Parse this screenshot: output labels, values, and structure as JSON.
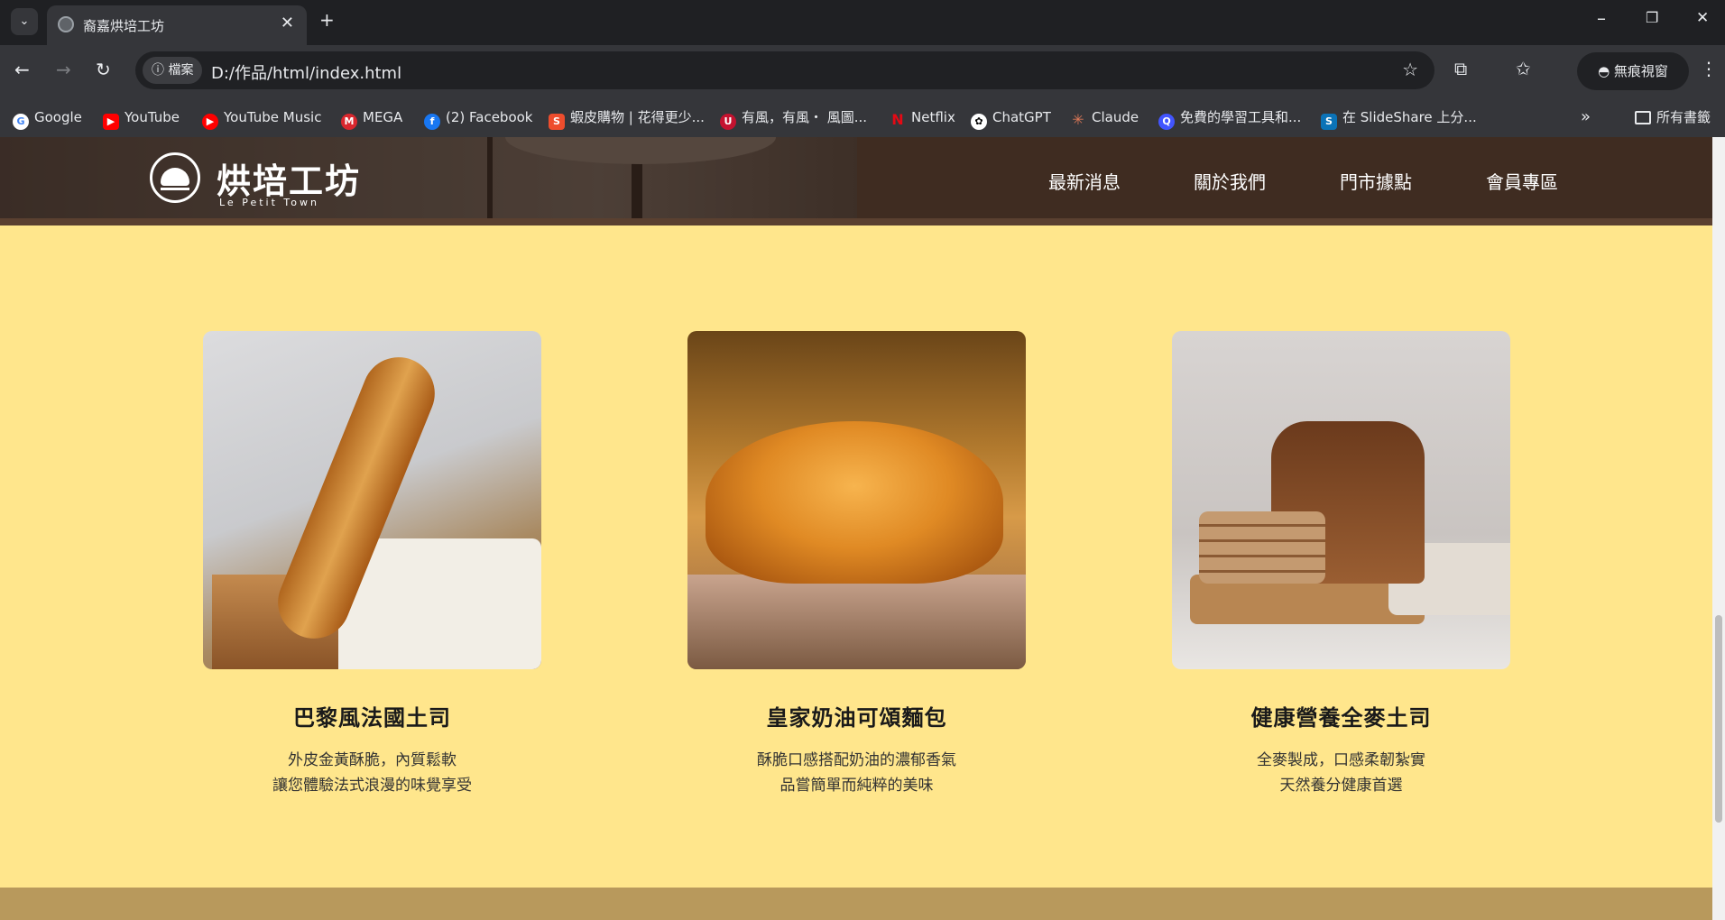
{
  "browser": {
    "tab_title": "裔嘉烘培工坊",
    "url_chip": "檔案",
    "url": "D:/作品/html/index.html",
    "incognito_label": "無痕視窗",
    "bookmarks": [
      "Google",
      "YouTube",
      "YouTube Music",
      "MEGA",
      "(2) Facebook",
      "蝦皮購物 | 花得更少...",
      "有風，有風・ 風圖...",
      "Netflix",
      "ChatGPT",
      "Claude",
      "免費的學習工具和...",
      "在 SlideShare 上分..."
    ],
    "all_bookmarks_label": "所有書籤"
  },
  "site": {
    "brand": "烘培工坊",
    "brand_sub": "Le Petit Town",
    "nav": [
      "最新消息",
      "關於我們",
      "門市據點",
      "會員專區"
    ]
  },
  "products": [
    {
      "name": "巴黎風法國土司",
      "desc1": "外皮金黃酥脆，內質鬆軟",
      "desc2": "讓您體驗法式浪漫的味覺享受"
    },
    {
      "name": "皇家奶油可頌麵包",
      "desc1": "酥脆口感搭配奶油的濃郁香氣",
      "desc2": "品嘗簡單而純粹的美味"
    },
    {
      "name": "健康營養全麥土司",
      "desc1": "全麥製成，口感柔韌紮實",
      "desc2": "天然養分健康首選"
    }
  ],
  "colors": {
    "page_bg": "#ffe68c",
    "header_bg": "#3f2c21",
    "footer_bg": "#b8995c"
  }
}
